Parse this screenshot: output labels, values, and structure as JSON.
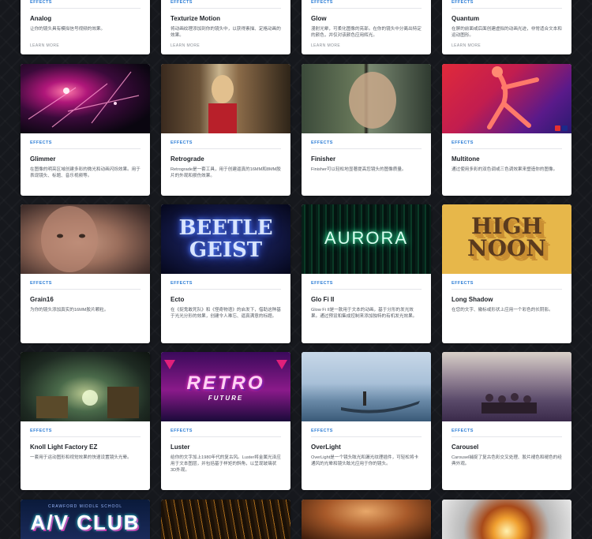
{
  "more_label": "LEARN MORE",
  "category_label": "EFFECTS",
  "thumb_titles": {
    "ecto": "BEETLE GEIST",
    "glofi": "AURORA",
    "longshadow": "HIGH NOON",
    "retro_main": "RETRO",
    "retro_sub": "FUTURE",
    "avclub": "A/V CLUB",
    "avclub_sub": "CRAWFORD MIDDLE SCHOOL"
  },
  "cards": {
    "analog": {
      "name": "Analog",
      "desc": "让你的镜头具有模拟信号视频的效果。"
    },
    "texturize": {
      "name": "Texturize Motion",
      "desc": "将动画纹理添加到你的镜头中，以获得素描、定格动画的效果。"
    },
    "glow": {
      "name": "Glow",
      "desc": "漫射光晕，可柔化图像的亮部。在你的镜头中分离出特定的颜色，并仅对该颜色应用辉光。"
    },
    "quantum": {
      "name": "Quantum",
      "desc": "在屏的前面或后面创建虚拟的动画光迹，非常适合文本和运动图形。"
    },
    "glimmer": {
      "name": "Glimmer",
      "desc": "在图像的明亮区域创建多彩的微光和动画闪烁效果。用于表现镜头、标题、音乐视频等。"
    },
    "retrograde": {
      "name": "Retrograde",
      "desc": "Retrograde是一套工具，用于创建逼真的16MM和8MM胶片的外观和损伤效果。"
    },
    "finisher": {
      "name": "Finisher",
      "desc": "Finisher可以轻松地显著提高您镜头的图像质量。"
    },
    "multitone": {
      "name": "Multitone",
      "desc": "通过使用多彩的双色调或三色调效果来塑造你的图像。"
    },
    "grain16": {
      "name": "Grain16",
      "desc": "为你的镜头添加真实的16MM胶片颗粒。"
    },
    "ecto": {
      "name": "Ecto",
      "desc": "在《捉鬼敢死队》和《怪奇物语》的启发下，借助这种基于光光分形的效果，创建令人难忘、逼真满意的标题。"
    },
    "glofi": {
      "name": "Glo Fi II",
      "desc": "Glow Fi II是一款用于文本的动画，基于分形的发光效果。通过预设和集成控制来添加独特的有机发光效果。"
    },
    "longshadow": {
      "name": "Long Shadow",
      "desc": "在您的文字、徽标或形状上应用一个彩色的长阴影。"
    },
    "knoll": {
      "name": "Knoll Light Factory EZ",
      "desc": "一套用于运动图形和视觉效果的快速设置镜头光晕。"
    },
    "luster": {
      "name": "Luster",
      "desc": "给你的文字加上1980年代的复古风。Luster将金属光泽应用于文本图层，并包括基于样矩的斜角，以呈现玻璃状3D外观。"
    },
    "overlight": {
      "name": "OverLight",
      "desc": "OverLight是一个镜头眩光和漏光纹理插件，可轻松将卡通风的光晕和镜头眩光应用于你的镜头。"
    },
    "carousel": {
      "name": "Carousel",
      "desc": "Carousel捕捉了复古色彩交叉处理、胶片褪色和褪色的经典外观。"
    }
  }
}
